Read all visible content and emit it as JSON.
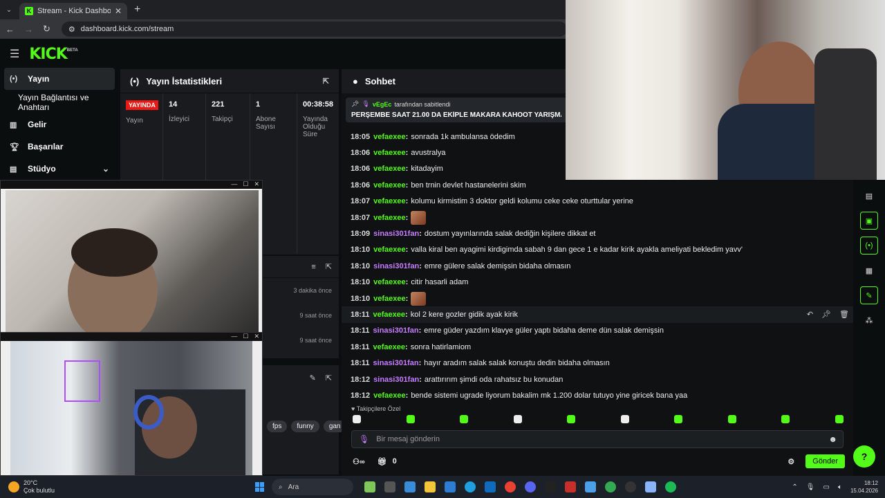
{
  "browser": {
    "tab_title": "Stream - Kick Dashboard",
    "url": "dashboard.kick.com/stream"
  },
  "brand": {
    "logo": "KICK",
    "badge": "BETA",
    "accent": "#53fc18"
  },
  "sidebar": {
    "items": [
      {
        "label": "Yayın",
        "icon": "broadcast-icon"
      },
      {
        "label": "Yayın Bağlantısı ve Anahtarı",
        "icon": ""
      },
      {
        "label": "Gelir",
        "icon": "chart-icon"
      },
      {
        "label": "Başarılar",
        "icon": "trophy-icon"
      },
      {
        "label": "Stüdyo",
        "icon": "studio-icon"
      }
    ]
  },
  "stats": {
    "title": "Yayın İstatistikleri",
    "live_badge": "YAYINDA",
    "live_label": "Yayın",
    "viewers": {
      "value": "14",
      "label": "İzleyici"
    },
    "followers": {
      "value": "221",
      "label": "Takipçi"
    },
    "subs": {
      "value": "1",
      "label": "Abone Sayısı"
    },
    "uptime": {
      "value": "00:38:58",
      "label": "Yayında Olduğu Süre"
    }
  },
  "events": [
    {
      "time": "3 dakika önce"
    },
    {
      "time": "9 saat önce"
    },
    {
      "time": "9 saat önce"
    }
  ],
  "tags": [
    "fps",
    "funny",
    "gan"
  ],
  "chat": {
    "title": "Sohbet",
    "pinned_by_user": "vEgEc",
    "pinned_by_text": "tarafından sabitlendi",
    "pinned_message": "PERŞEMBE SAAT 21.00 DA EKİPLE MAKARA KAHOOT YARIŞMASI VAR",
    "messages": [
      {
        "time": "18:05",
        "user": "vefaexee",
        "text": "sonrada 1k ambulansa ödedim",
        "color": "green"
      },
      {
        "time": "18:06",
        "user": "vefaexee",
        "text": "avustralya",
        "color": "green"
      },
      {
        "time": "18:06",
        "user": "vefaexee",
        "text": "kitadayim",
        "color": "green"
      },
      {
        "time": "18:06",
        "user": "vefaexee",
        "text": "ben trnin devlet hastanelerini skim",
        "color": "green"
      },
      {
        "time": "18:07",
        "user": "vefaexee",
        "text": "kolumu kirmistim 3 doktor geldi kolumu ceke ceke oturttular yerine",
        "color": "green"
      },
      {
        "time": "18:07",
        "user": "vefaexee",
        "text": "",
        "color": "green",
        "emote": true
      },
      {
        "time": "18:09",
        "user": "sinasi301fan",
        "text": "dostum yayınlarında salak dediğin kişilere dikkat et",
        "color": "purple"
      },
      {
        "time": "18:10",
        "user": "vefaexee",
        "text": "valla kiral ben ayagimi kirdigimda sabah 9 dan gece 1 e kadar kirik ayakla ameliyati bekledim yavv'",
        "color": "green"
      },
      {
        "time": "18:10",
        "user": "sinasi301fan",
        "text": "emre gülere salak demişsin bidaha olmasın",
        "color": "purple"
      },
      {
        "time": "18:10",
        "user": "vefaexee",
        "text": "citir hasarli adam",
        "color": "green"
      },
      {
        "time": "18:10",
        "user": "vefaexee",
        "text": "",
        "color": "green",
        "emote": true
      },
      {
        "time": "18:11",
        "user": "vefaexee",
        "text": "kol 2 kere gozler gidik ayak kirik",
        "color": "green",
        "highlight": true
      },
      {
        "time": "18:11",
        "user": "sinasi301fan",
        "text": "emre güder yazdım klavye güler yaptı bidaha deme dün salak demişsin",
        "color": "purple"
      },
      {
        "time": "18:11",
        "user": "vefaexee",
        "text": "sonra hatirlamiom",
        "color": "green"
      },
      {
        "time": "18:11",
        "user": "sinasi301fan",
        "text": "hayır aradım salak salak konuştu dedin bidaha olmasın",
        "color": "purple"
      },
      {
        "time": "18:12",
        "user": "sinasi301fan",
        "text": "arattırırım şimdi oda rahatsız bu konudan",
        "color": "purple"
      },
      {
        "time": "18:12",
        "user": "vefaexee",
        "text": "bende sistemi ugrade liyorum bakalim mk 1.200 dolar tutuyo yine giricek bana yaa",
        "color": "green"
      }
    ],
    "subscriber_only_label": "Takipçilere Özel",
    "input_placeholder": "Bir mesaj gönderin",
    "points_count": "0",
    "send_label": "Gönder"
  },
  "taskbar": {
    "temperature": "20°C",
    "weather": "Çok bulutlu",
    "search_label": "Ara",
    "time": "18:12",
    "date": "15.04.2026"
  }
}
